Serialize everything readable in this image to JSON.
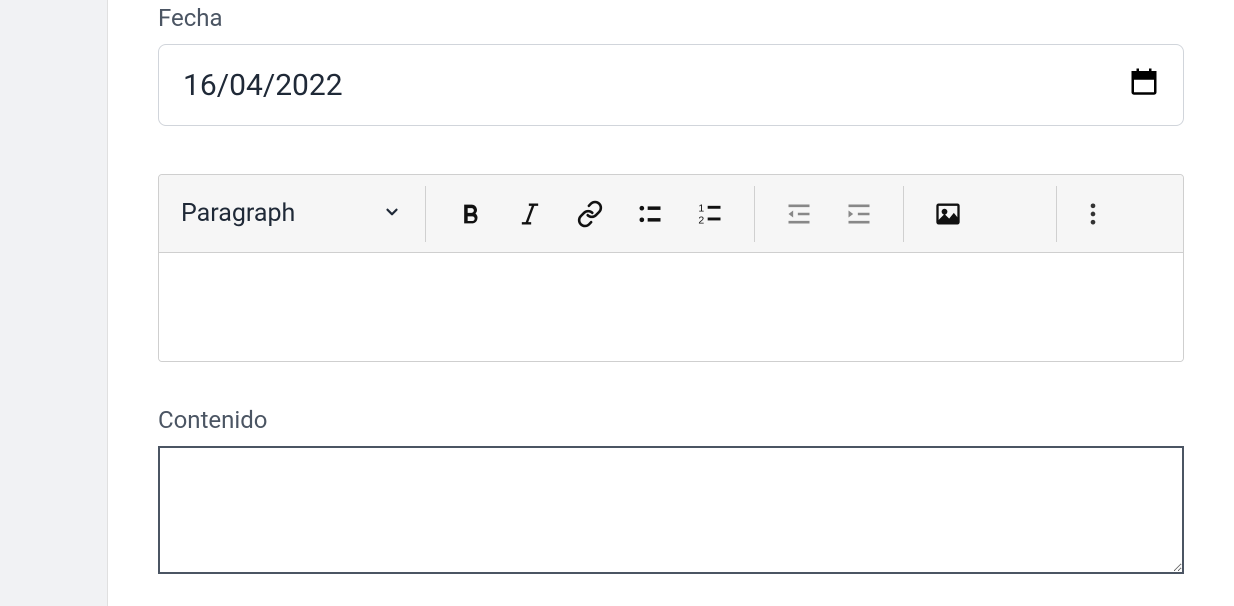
{
  "fields": {
    "date": {
      "label": "Fecha",
      "value": "16/04/2022"
    },
    "content": {
      "label": "Contenido",
      "value": ""
    }
  },
  "editor": {
    "styleDropdown": "Paragraph",
    "content": ""
  }
}
